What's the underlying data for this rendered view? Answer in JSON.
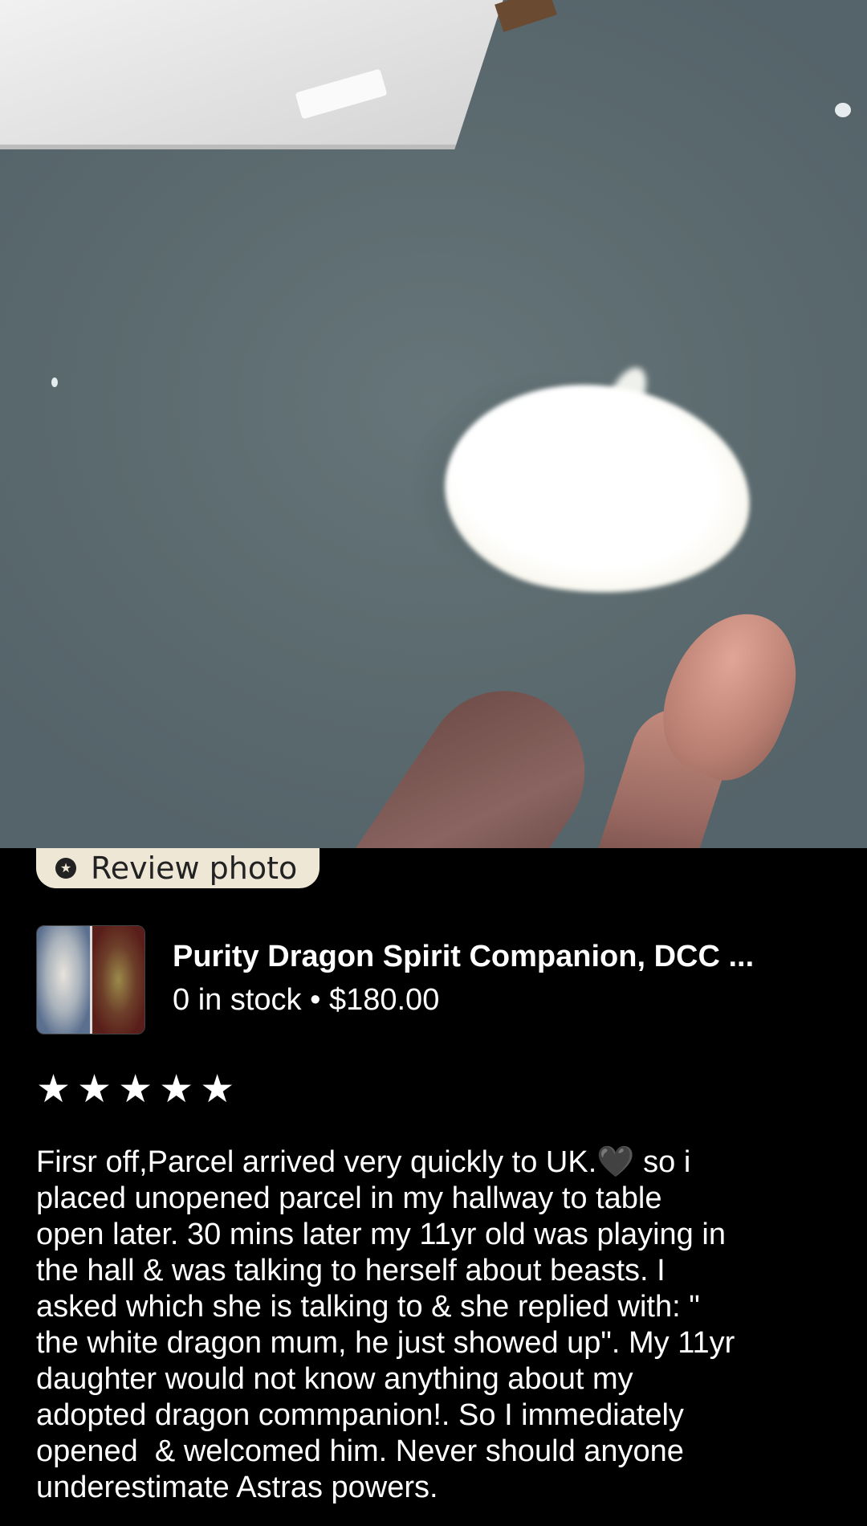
{
  "photo": {
    "alt": "Review photo content"
  },
  "review_badge": {
    "label": "Review photo",
    "icon": "star-badge-icon"
  },
  "product": {
    "title": "Purity Dragon Spirit Companion, DCC ...",
    "stock": "0 in stock",
    "separator": "•",
    "price": "$180.00"
  },
  "rating": {
    "stars": 5,
    "max": 5
  },
  "review": {
    "text": "Firsr off,Parcel arrived very quickly to UK.🖤 so i\nplaced unopened parcel in my hallway to table\nopen later. 30 mins later my 11yr old was playing in\nthe hall & was talking to herself about beasts. I\nasked which she is talking to & she replied with: \"\nthe white dragon mum, he just showed up\". My 11yr\ndaughter would not know anything about my\nadopted dragon commpanion!. So I immediately\nopened  & welcomed him. Never should anyone\nunderestimate Astras powers."
  },
  "colors": {
    "background": "#000000",
    "text": "#ffffff",
    "pill_bg": "#efe7d6"
  }
}
